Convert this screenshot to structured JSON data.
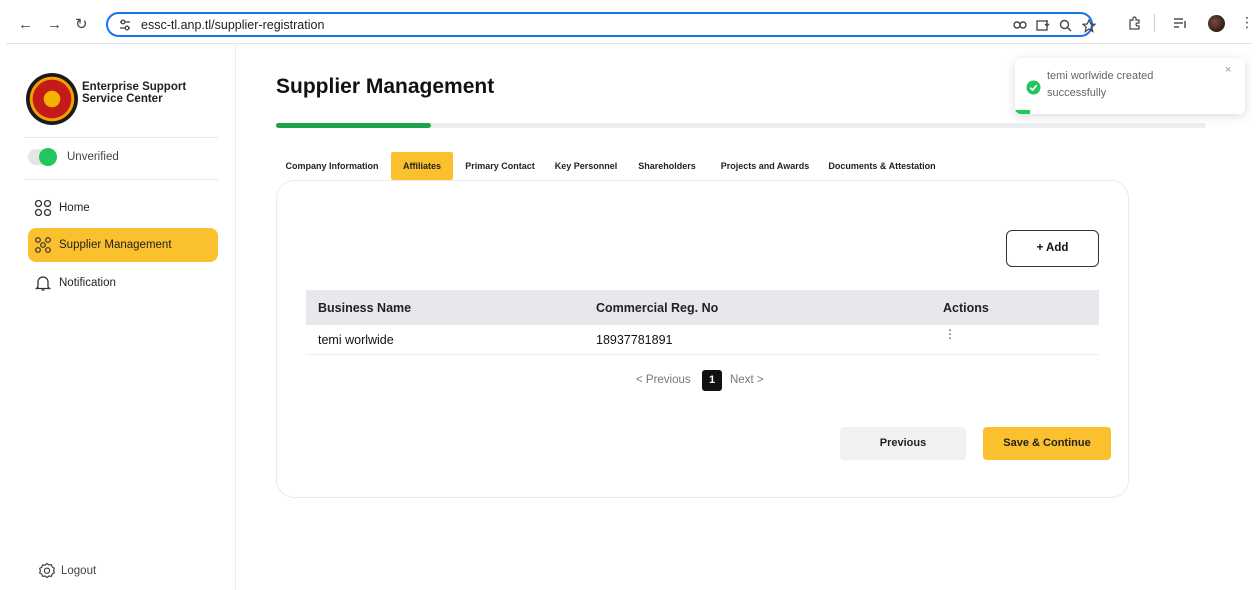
{
  "browser": {
    "url": "essc-tl.anp.tl/supplier-registration"
  },
  "sidebar": {
    "org_name": "Enterprise Support Service Center",
    "status": "Unverified",
    "items": [
      {
        "label": "Home",
        "icon": "grid-circles-icon",
        "active": false
      },
      {
        "label": "Supplier Management",
        "icon": "network-icon",
        "active": true
      },
      {
        "label": "Notification",
        "icon": "bell-icon",
        "active": false
      }
    ],
    "logout_label": "Logout"
  },
  "main": {
    "title": "Supplier Management",
    "progress": 0.167,
    "tabs": [
      {
        "label": "Company Information",
        "active": false
      },
      {
        "label": "Affiliates",
        "active": true
      },
      {
        "label": "Primary Contact",
        "active": false
      },
      {
        "label": "Key Personnel",
        "active": false
      },
      {
        "label": "Shareholders",
        "active": false
      },
      {
        "label": "Projects and Awards",
        "active": false
      },
      {
        "label": "Documents & Attestation",
        "active": false
      }
    ],
    "add_label": "+ Add",
    "table": {
      "headers": [
        "Business Name",
        "Commercial Reg. No",
        "Actions"
      ],
      "rows": [
        [
          "temi worlwide",
          "18937781891"
        ]
      ]
    },
    "pagination": {
      "prev": "< Previous",
      "current": "1",
      "next": "Next >"
    },
    "previous_label": "Previous",
    "save_label": "Save & Continue"
  },
  "toast": {
    "message": "temi worlwide created successfully",
    "close": "×"
  },
  "colors": {
    "accent": "#fbc02d",
    "success": "#22c55e",
    "progress": "#1fa34a",
    "focus": "#1a73e8"
  }
}
